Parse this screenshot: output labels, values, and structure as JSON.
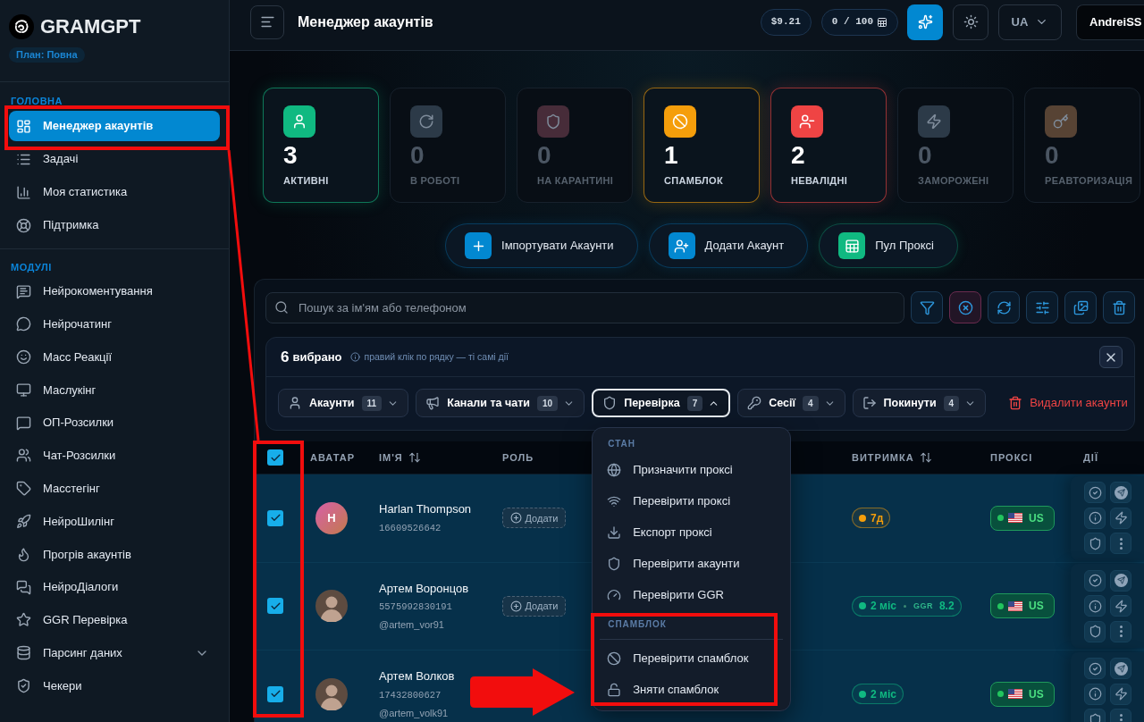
{
  "sidebar": {
    "logo": "GRAMGPT",
    "plan": "План: Повна",
    "sections": [
      {
        "title": "ГОЛОВНА",
        "items": [
          {
            "label": "Менеджер акаунтів",
            "selected": true
          },
          {
            "label": "Задачі",
            "selected": false
          },
          {
            "label": "Моя статистика",
            "selected": false
          },
          {
            "label": "Підтримка",
            "selected": false
          }
        ]
      },
      {
        "title": "МОДУЛІ",
        "items": [
          {
            "label": "Нейрокоментування",
            "selected": false
          },
          {
            "label": "Нейрочатинг",
            "selected": false
          },
          {
            "label": "Масс Реакції",
            "selected": false
          },
          {
            "label": "Маслукінг",
            "selected": false
          },
          {
            "label": "ОП-Розсилки",
            "selected": false
          },
          {
            "label": "Чат-Розсилки",
            "selected": false
          },
          {
            "label": "Масстегінг",
            "selected": false
          },
          {
            "label": "НейроШилінг",
            "selected": false
          },
          {
            "label": "Прогрів акаунтів",
            "selected": false
          },
          {
            "label": "НейроДіалоги",
            "selected": false
          },
          {
            "label": "GGR Перевірка",
            "selected": false
          },
          {
            "label": "Парсинг даних",
            "selected": false,
            "expanded": false
          },
          {
            "label": "Чекери",
            "selected": false
          }
        ]
      }
    ]
  },
  "header": {
    "title": "Менеджер акаунтів",
    "balance": "$9.21",
    "quota": "0 / 100",
    "language": "UA",
    "user": "AndreiSS"
  },
  "stats": [
    {
      "value": "3",
      "label": "АКТИВНІ",
      "color": "#10b981",
      "highlighted": true
    },
    {
      "value": "0",
      "label": "В РОБОТІ",
      "color": "#2c3a48",
      "highlighted": false
    },
    {
      "value": "0",
      "label": "НА КАРАНТИНІ",
      "color": "#472c39",
      "highlighted": false
    },
    {
      "value": "1",
      "label": "СПАМБЛОК",
      "color": "#f59e0b",
      "highlighted": true
    },
    {
      "value": "2",
      "label": "НЕВАЛІДНІ",
      "color": "#ef4444",
      "highlighted": true
    },
    {
      "value": "0",
      "label": "ЗАМОРОЖЕНІ",
      "color": "#2c3a48",
      "highlighted": false
    },
    {
      "value": "0",
      "label": "РЕАВТОРИЗАЦІЯ",
      "color": "#574334",
      "highlighted": false
    }
  ],
  "actions": [
    {
      "label": "Імпортувати Акаунти",
      "color": "#0288d1"
    },
    {
      "label": "Додати Акаунт",
      "color": "#0288d1"
    },
    {
      "label": "Пул Проксі",
      "color": "#10b981"
    }
  ],
  "search": {
    "placeholder": "Пошук за ім'ям або телефоном"
  },
  "selection": {
    "count": "6",
    "label": "вибрано",
    "hint": "правий клік по рядку — ті самі дії",
    "groups": [
      {
        "label": "Акаунти",
        "count": "11",
        "expanded": false
      },
      {
        "label": "Канали та чати",
        "count": "10",
        "expanded": false
      },
      {
        "label": "Перевірка",
        "count": "7",
        "expanded": true
      },
      {
        "label": "Сесії",
        "count": "4",
        "expanded": false
      },
      {
        "label": "Покинути",
        "count": "4",
        "expanded": false
      }
    ],
    "delete": "Видалити акаунти"
  },
  "menu": {
    "sections": [
      {
        "title": "СТАН",
        "items": [
          "Призначити проксі",
          "Перевірити проксі",
          "Експорт проксі",
          "Перевірити акаунти",
          "Перевірити GGR"
        ]
      },
      {
        "title": "СПАМБЛОК",
        "items": [
          "Перевірити спамблок",
          "Зняти спамблок"
        ]
      }
    ]
  },
  "table": {
    "all_selected": true,
    "columns": [
      {
        "label": "АВАТАР",
        "sortable": false
      },
      {
        "label": "ІМ'Я",
        "sortable": true
      },
      {
        "label": "РОЛЬ",
        "sortable": false
      },
      {
        "label": "ВИТРИМКА",
        "sortable": true
      },
      {
        "label": "ПРОКСІ",
        "sortable": false
      },
      {
        "label": "ДІЇ",
        "sortable": false
      }
    ],
    "rows": [
      {
        "selected": true,
        "avatar": {
          "kind": "letter",
          "letter": "H"
        },
        "name": "Harlan Thompson",
        "phone": "16609526642",
        "role": "Додати",
        "age": {
          "text": "7д",
          "color": "#f59e0b"
        },
        "proxy": "US"
      },
      {
        "selected": true,
        "avatar": {
          "kind": "photo"
        },
        "name": "Артем Воронцов",
        "phone": "5575992830191",
        "username": "@artem_vor91",
        "role": "Додати",
        "age": {
          "text": "2 міс",
          "color": "#10b981",
          "ggr_label": "GGR",
          "ggr": "8.2"
        },
        "proxy": "US"
      },
      {
        "selected": true,
        "avatar": {
          "kind": "photo"
        },
        "name": "Артем Волков",
        "phone": "17432800627",
        "username": "@artem_volk91",
        "age": {
          "text": "2 міс",
          "color": "#10b981"
        },
        "proxy": "US"
      }
    ]
  }
}
